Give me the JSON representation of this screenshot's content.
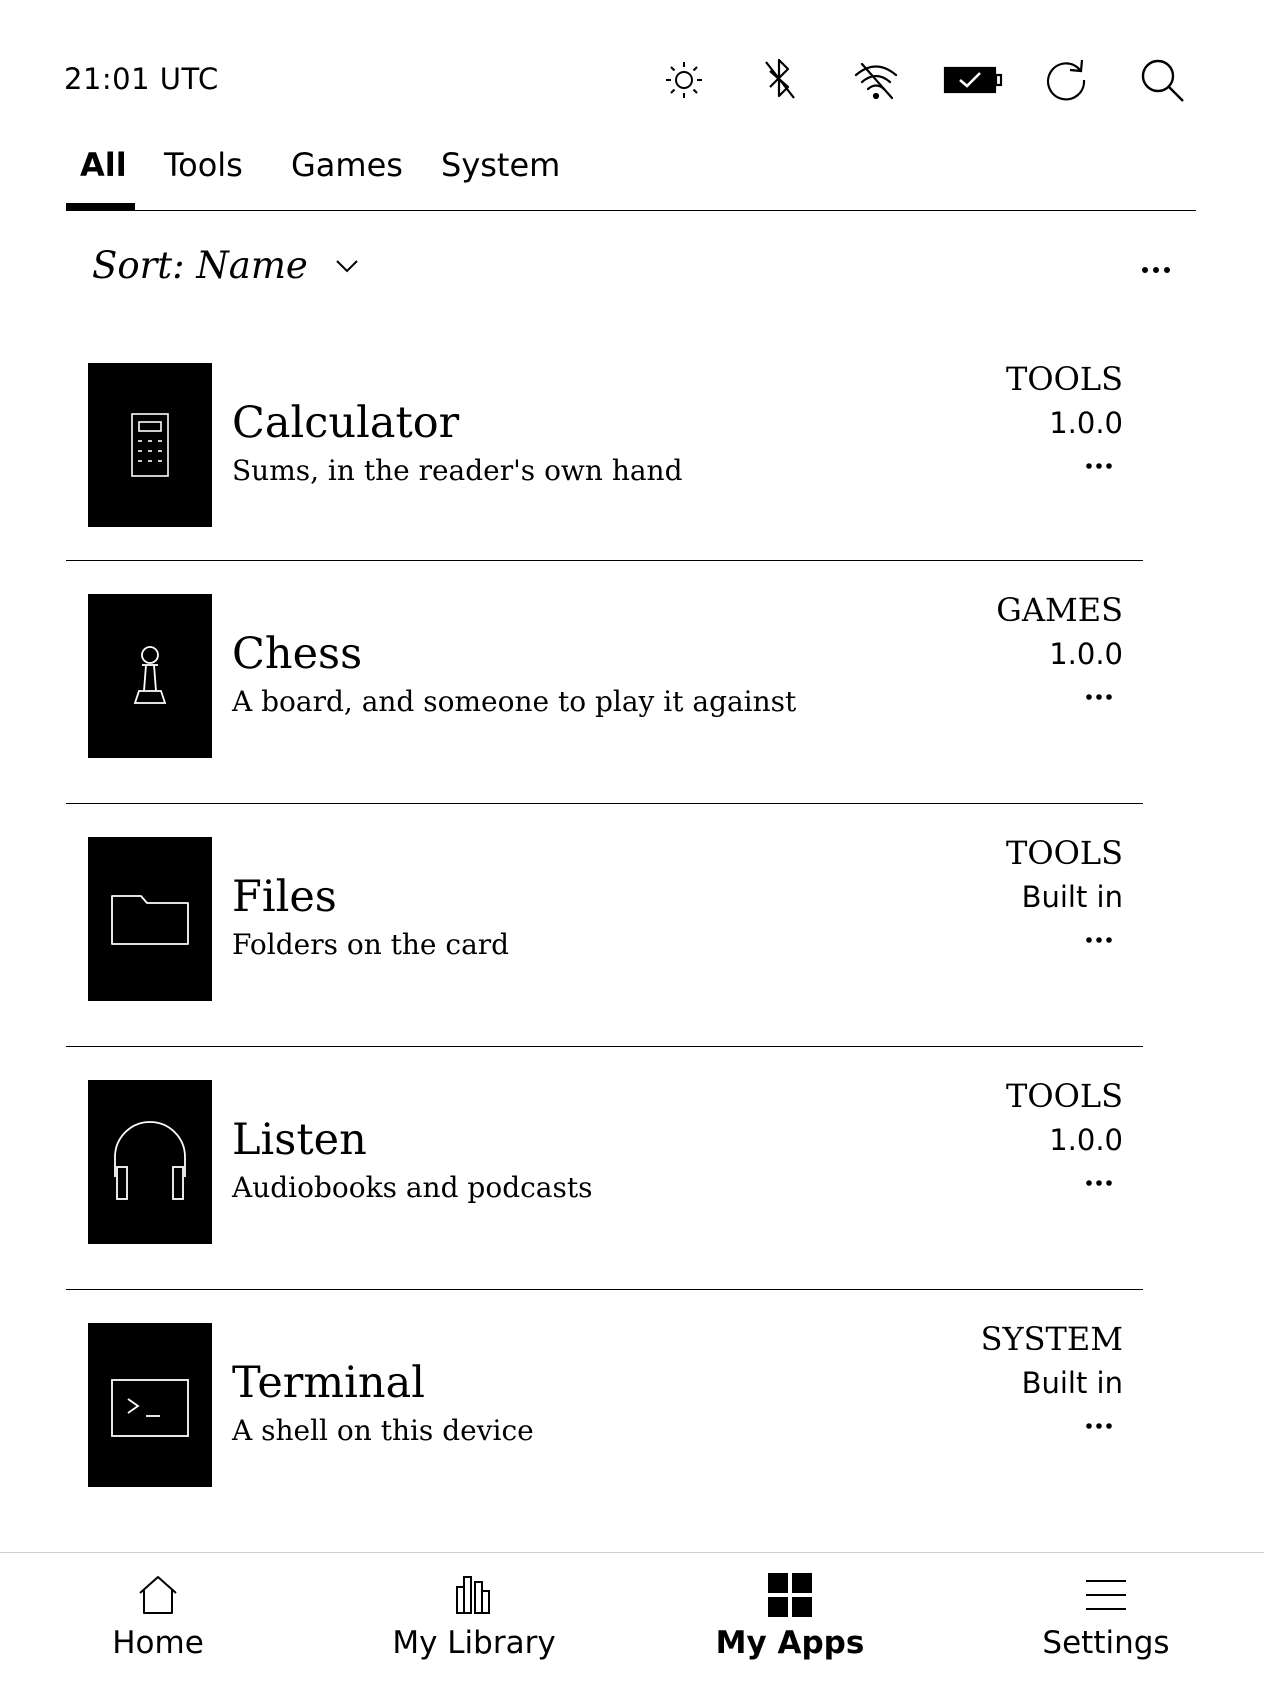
{
  "status_bar": {
    "time": "21:01 UTC",
    "icons": [
      "brightness-icon",
      "bluetooth-off-icon",
      "wifi-off-icon",
      "battery-charging-icon",
      "sync-icon",
      "search-icon"
    ]
  },
  "tabs": [
    {
      "label": "All",
      "active": true
    },
    {
      "label": "Tools",
      "active": false
    },
    {
      "label": "Games",
      "active": false
    },
    {
      "label": "System",
      "active": false
    }
  ],
  "sort": {
    "label": "Sort: Name"
  },
  "apps": [
    {
      "name": "Calculator",
      "description": "Sums, in the reader's own hand",
      "category": "TOOLS",
      "version": "1.0.0",
      "icon": "calculator-icon"
    },
    {
      "name": "Chess",
      "description": "A board, and someone to play it against",
      "category": "GAMES",
      "version": "1.0.0",
      "icon": "chess-pawn-icon"
    },
    {
      "name": "Files",
      "description": "Folders on the card",
      "category": "TOOLS",
      "version": "Built in",
      "icon": "folder-icon"
    },
    {
      "name": "Listen",
      "description": "Audiobooks and podcasts",
      "category": "TOOLS",
      "version": "1.0.0",
      "icon": "headphones-icon"
    },
    {
      "name": "Terminal",
      "description": "A shell on this device",
      "category": "SYSTEM",
      "version": "Built in",
      "icon": "terminal-icon"
    }
  ],
  "bottom_nav": [
    {
      "label": "Home",
      "icon": "home-icon",
      "active": false
    },
    {
      "label": "My Library",
      "icon": "library-icon",
      "active": false
    },
    {
      "label": "My Apps",
      "icon": "apps-grid-icon",
      "active": true
    },
    {
      "label": "Settings",
      "icon": "menu-icon",
      "active": false
    }
  ]
}
